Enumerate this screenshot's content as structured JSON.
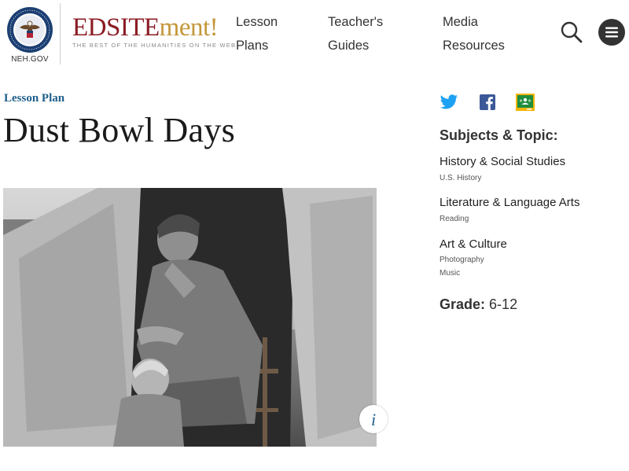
{
  "header": {
    "seal_caption": "NEH.GOV",
    "logo_edsite": "EDSITE",
    "logo_ment": "ment!",
    "logo_tagline": "THE BEST OF THE HUMANITIES ON THE WEB",
    "nav": [
      {
        "line1": "Lesson",
        "line2": "Plans"
      },
      {
        "line1": "Teacher's",
        "line2": "Guides"
      },
      {
        "line1": "Media",
        "line2": "Resources"
      }
    ]
  },
  "main": {
    "kicker": "Lesson Plan",
    "title": "Dust Bowl Days",
    "photo_info_label": "i"
  },
  "sidebar": {
    "subjects_heading": "Subjects & Topic:",
    "subjects": [
      {
        "name": "History & Social Studies",
        "topics": [
          "U.S. History"
        ]
      },
      {
        "name": "Literature & Language Arts",
        "topics": [
          "Reading"
        ]
      },
      {
        "name": "Art & Culture",
        "topics": [
          "Photography",
          "Music"
        ]
      }
    ],
    "grade_label": "Grade:",
    "grade_value": "6-12"
  },
  "icons": {
    "search": "search-icon",
    "menu": "hamburger-menu-icon",
    "twitter": "twitter-icon",
    "facebook": "facebook-icon",
    "classroom": "google-classroom-icon"
  },
  "colors": {
    "accent_blue": "#1f5f8b",
    "logo_red": "#8b1c24",
    "logo_gold": "#c4973a",
    "twitter_blue": "#1da1f2",
    "facebook_blue": "#3b5998",
    "classroom_green": "#1e8e3e",
    "classroom_yellow": "#f4b400"
  }
}
